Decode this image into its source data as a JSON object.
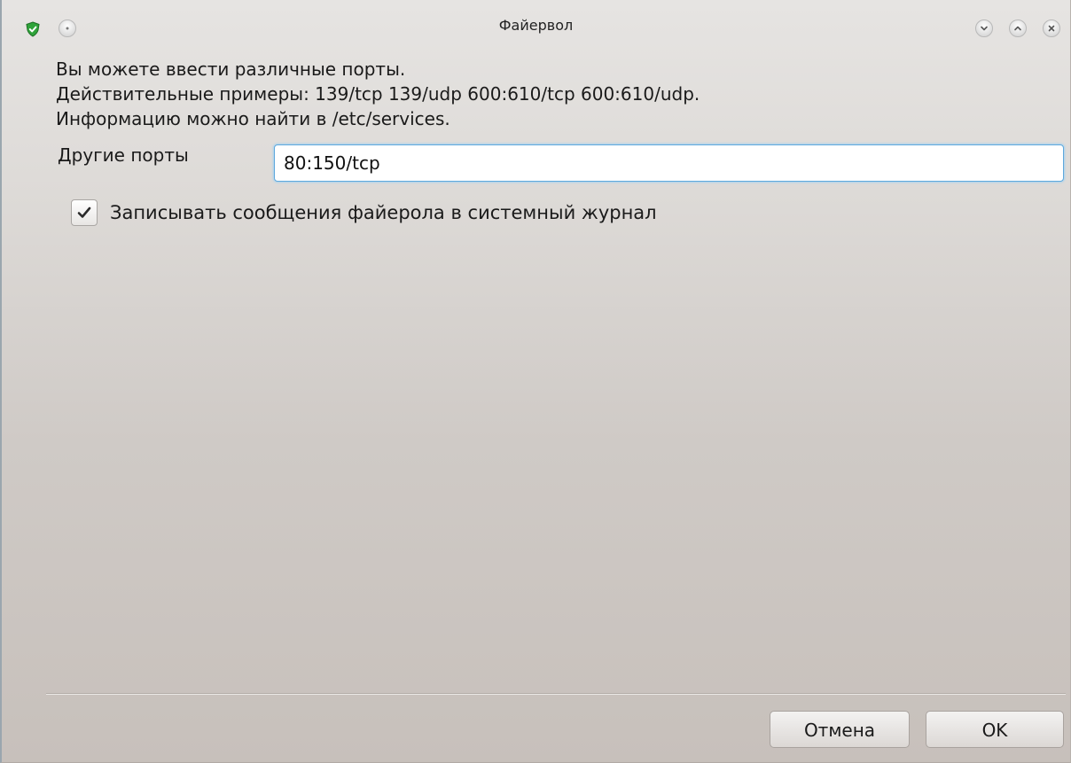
{
  "window": {
    "title": "Файервол"
  },
  "info": {
    "line1": "Вы можете ввести различные порты.",
    "line2": "Действительные примеры: 139/tcp 139/udp 600:610/tcp 600:610/udp.",
    "line3": "Информацию можно найти в /etc/services."
  },
  "ports": {
    "label": "Другие порты",
    "value": "80:150/tcp"
  },
  "log_option": {
    "label": "Записывать сообщения файерола в системный журнал",
    "checked": true
  },
  "buttons": {
    "cancel": "Отмена",
    "ok": "OK"
  },
  "icons": {
    "app": "shield-check-icon",
    "menu": "circle-dot-icon",
    "minimize": "chevron-down-icon",
    "maximize": "chevron-up-icon",
    "close": "close-icon"
  },
  "colors": {
    "focus_border": "#5ea8dc",
    "shield_green": "#2fa33a"
  }
}
